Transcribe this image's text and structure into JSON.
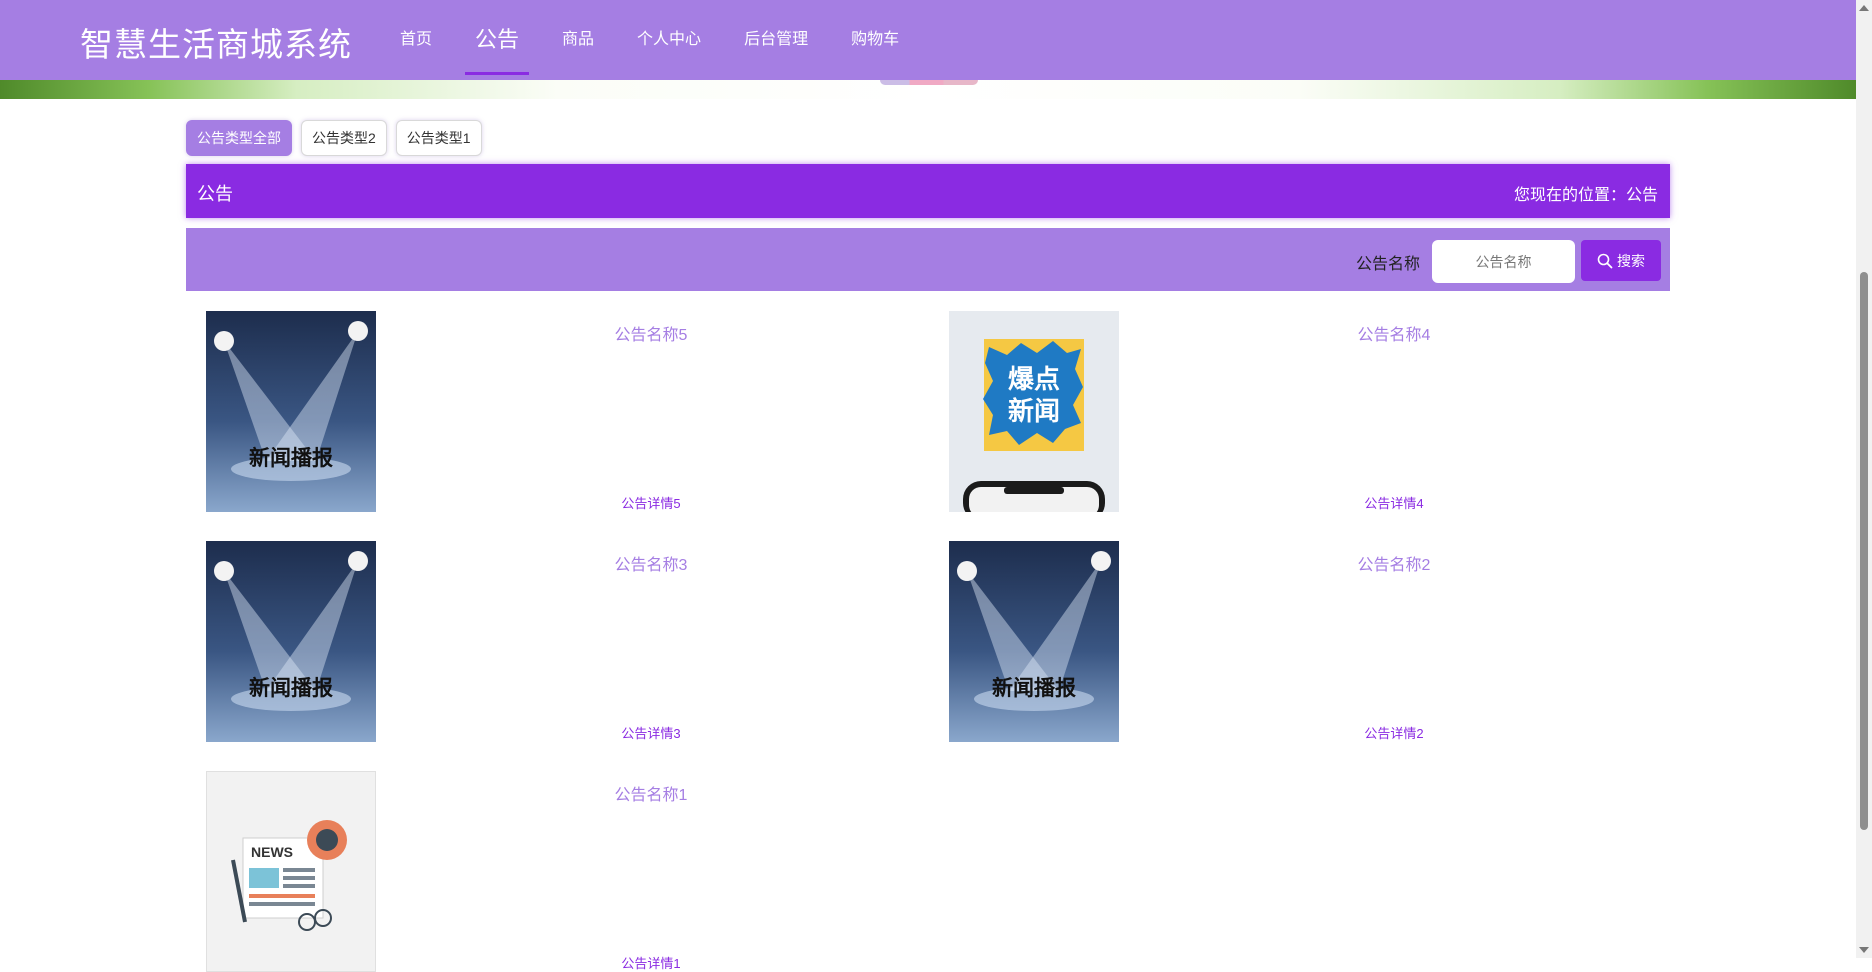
{
  "header": {
    "brand": "智慧生活商城系统",
    "nav": [
      {
        "label": "首页",
        "active": false
      },
      {
        "label": "公告",
        "active": true
      },
      {
        "label": "商品",
        "active": false
      },
      {
        "label": "个人中心",
        "active": false
      },
      {
        "label": "后台管理",
        "active": false
      },
      {
        "label": "购物车",
        "active": false
      }
    ]
  },
  "filters": [
    {
      "label": "公告类型全部",
      "active": true
    },
    {
      "label": "公告类型2",
      "active": false
    },
    {
      "label": "公告类型1",
      "active": false
    }
  ],
  "title_bar": {
    "title": "公告",
    "location": "您现在的位置：公告"
  },
  "search": {
    "label": "公告名称",
    "placeholder": "公告名称",
    "button_label": "搜索"
  },
  "notices": [
    {
      "name": "公告名称5",
      "detail": "公告详情5",
      "image_text": "新闻播报",
      "image_icon": "spotlight-image"
    },
    {
      "name": "公告名称4",
      "detail": "公告详情4",
      "image_text": "爆点新闻",
      "image_icon": "breaking-news-phone-image"
    },
    {
      "name": "公告名称3",
      "detail": "公告详情3",
      "image_text": "新闻播报",
      "image_icon": "spotlight-image"
    },
    {
      "name": "公告名称2",
      "detail": "公告详情2",
      "image_text": "新闻播报",
      "image_icon": "spotlight-image"
    },
    {
      "name": "公告名称1",
      "detail": "公告详情1",
      "image_text": "NEWS",
      "image_icon": "newspaper-image"
    }
  ],
  "colors": {
    "header": "#a57ee3",
    "accent": "#8a2be2",
    "link": "#a57ee3"
  }
}
